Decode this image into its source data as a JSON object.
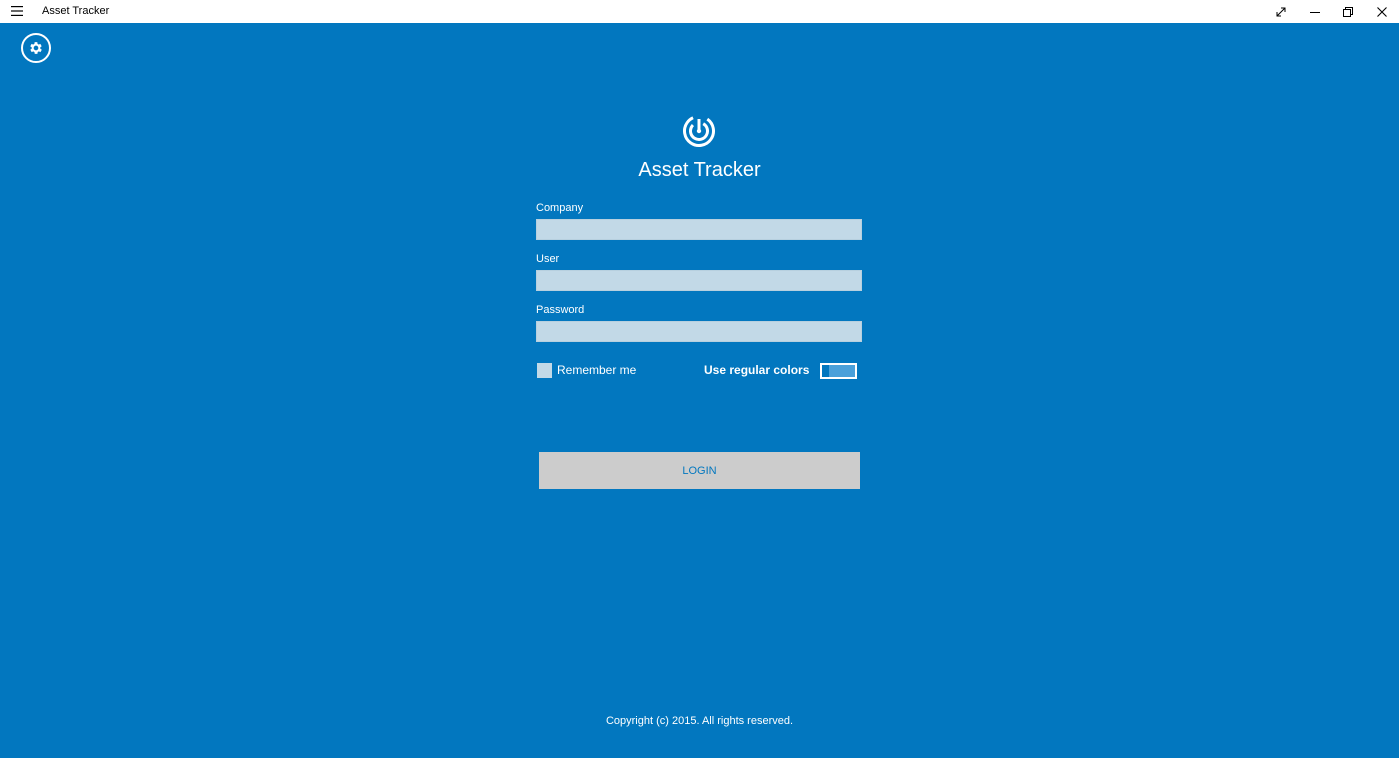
{
  "window": {
    "title": "Asset Tracker",
    "icons": {
      "menu": "hamburger-icon",
      "fullscreen": "expand-icon",
      "minimize": "minimize-icon",
      "restore": "restore-icon",
      "close": "close-icon"
    }
  },
  "app": {
    "title": "Asset Tracker",
    "logo": "radar-logo-icon",
    "settings_icon": "gear-icon",
    "background_color": "#0277bf"
  },
  "form": {
    "company": {
      "label": "Company",
      "value": "",
      "placeholder": ""
    },
    "user": {
      "label": "User",
      "value": "",
      "placeholder": ""
    },
    "password": {
      "label": "Password",
      "value": "",
      "placeholder": ""
    },
    "remember_me": {
      "label": "Remember me",
      "checked": false
    },
    "use_regular_colors": {
      "label": "Use regular colors",
      "on": false
    },
    "login_label": "LOGIN"
  },
  "footer": {
    "copyright": "Copyright (c) 2015. All rights reserved."
  }
}
